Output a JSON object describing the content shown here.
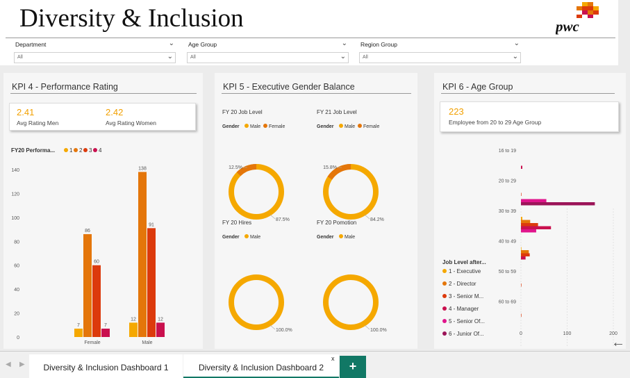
{
  "header": {
    "title": "Diversity & Inclusion",
    "logo_text": "pwc"
  },
  "slicers": [
    {
      "label": "Department",
      "value": "All"
    },
    {
      "label": "Age Group",
      "value": "All"
    },
    {
      "label": "Region Group",
      "value": "All"
    }
  ],
  "kpi4": {
    "title": "KPI 4 - Performance Rating",
    "card": {
      "men_value": "2.41",
      "men_label": "Avg Rating Men",
      "women_value": "2.42",
      "women_label": "Avg Rating Women"
    },
    "legend_title": "FY20 Performa...",
    "legend": [
      "1",
      "2",
      "3",
      "4"
    ]
  },
  "kpi5": {
    "title": "KPI 5 - Executive Gender Balance",
    "gender_label": "Gender",
    "male_label": "Male",
    "female_label": "Female",
    "donuts": [
      {
        "title": "FY 20 Job Level",
        "female_pct": "12.5%",
        "male_pct": "87.5%",
        "male_share": 0.875,
        "show_female_legend": true
      },
      {
        "title": "FY 21 Job Level",
        "female_pct": "15.8%",
        "male_pct": "84.2%",
        "male_share": 0.842,
        "show_female_legend": true
      },
      {
        "title": "FY 20 Hires",
        "female_pct": "",
        "male_pct": "100.0%",
        "male_share": 1.0,
        "show_female_legend": false
      },
      {
        "title": "FY 20 Pomotion",
        "female_pct": "",
        "male_pct": "100.0%",
        "male_share": 1.0,
        "show_female_legend": false
      }
    ]
  },
  "kpi6": {
    "title": "KPI 6 - Age Group",
    "card": {
      "value": "223",
      "label": "Employee from 20 to 29 Age Group"
    },
    "legend_title": "Job Level after...",
    "legend": [
      "1 - Executive",
      "2 - Director",
      "3 - Senior M...",
      "4 - Manager",
      "5 - Senior Of...",
      "6 - Junior Of..."
    ]
  },
  "tabs": {
    "tab1": "Diversity & Inclusion Dashboard 1",
    "tab2": "Diversity & Inclusion Dashboard 2",
    "close": "x",
    "add": "+"
  },
  "colors": {
    "c1": "#f5a800",
    "c2": "#e4760a",
    "c3": "#dc3a0c",
    "c4": "#c9104e",
    "c5": "#e0148c",
    "c6": "#9b1458",
    "teal": "#117865"
  },
  "chart_data": [
    {
      "type": "bar",
      "title": "",
      "categories": [
        "Female",
        "Male"
      ],
      "series": [
        {
          "name": "1",
          "values": [
            7,
            12
          ]
        },
        {
          "name": "2",
          "values": [
            86,
            138
          ]
        },
        {
          "name": "3",
          "values": [
            60,
            91
          ]
        },
        {
          "name": "4",
          "values": [
            7,
            12
          ]
        }
      ],
      "yticks": [
        "0",
        "20",
        "40",
        "60",
        "80",
        "100",
        "120",
        "140"
      ],
      "ylim": [
        0,
        140
      ]
    },
    {
      "type": "bar",
      "orientation": "horizontal",
      "categories": [
        "16 to 19",
        "20 to 29",
        "30 to 39",
        "40 to 49",
        "50 to 59",
        "60 to 69"
      ],
      "series": [
        {
          "name": "1 - Executive",
          "values": [
            0,
            0,
            3,
            1,
            0,
            0
          ]
        },
        {
          "name": "2 - Director",
          "values": [
            0,
            0,
            20,
            17,
            0,
            0
          ]
        },
        {
          "name": "3 - Senior M...",
          "values": [
            0,
            1,
            37,
            19,
            1,
            1
          ]
        },
        {
          "name": "4 - Manager",
          "values": [
            3,
            0,
            65,
            10,
            0,
            0
          ]
        },
        {
          "name": "5 - Senior Of...",
          "values": [
            0,
            55,
            33,
            0,
            0,
            0
          ]
        },
        {
          "name": "6 - Junior Of...",
          "values": [
            0,
            160,
            0,
            0,
            0,
            0
          ]
        }
      ],
      "xticks": [
        "0",
        "100",
        "200"
      ],
      "xlim": [
        0,
        200
      ]
    }
  ]
}
